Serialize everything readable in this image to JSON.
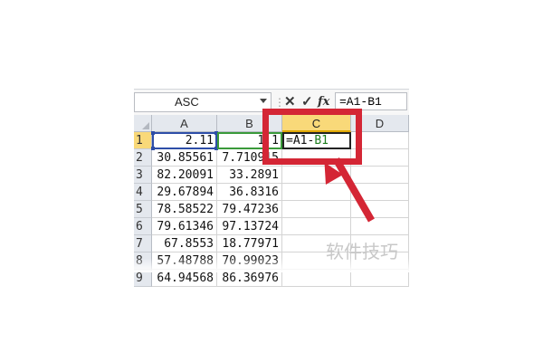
{
  "formula_bar": {
    "name_box": "ASC",
    "content": "=A1-B1",
    "cancel_icon": "✕",
    "enter_icon": "✓",
    "fx_icon": "fx"
  },
  "grid": {
    "columns": [
      "A",
      "B",
      "C",
      "D"
    ],
    "active_column": "C",
    "rows": [
      {
        "num": "1",
        "a": "2.11",
        "b": "1.1",
        "c": "=A1-B1"
      },
      {
        "num": "2",
        "a": "30.85561",
        "b": "7.710915",
        "c": ""
      },
      {
        "num": "3",
        "a": "82.20091",
        "b": "33.2891",
        "c": ""
      },
      {
        "num": "4",
        "a": "29.67894",
        "b": "36.8316",
        "c": ""
      },
      {
        "num": "5",
        "a": "78.58522",
        "b": "79.47236",
        "c": ""
      },
      {
        "num": "6",
        "a": "79.61346",
        "b": "97.13724",
        "c": ""
      },
      {
        "num": "7",
        "a": "67.8553",
        "b": "18.77971",
        "c": ""
      },
      {
        "num": "8",
        "a": "57.48788",
        "b": "70.99023",
        "c": ""
      },
      {
        "num": "9",
        "a": "64.94568",
        "b": "86.36976",
        "c": ""
      }
    ],
    "editing_cell": {
      "prefix": "=A1-",
      "ref": "B1"
    }
  },
  "watermark": "软件技巧",
  "colors": {
    "annotation": "#d42635",
    "active_header": "#f9d979",
    "ref_a1": "#2e4ea8",
    "ref_b1": "#3a9a3a"
  }
}
